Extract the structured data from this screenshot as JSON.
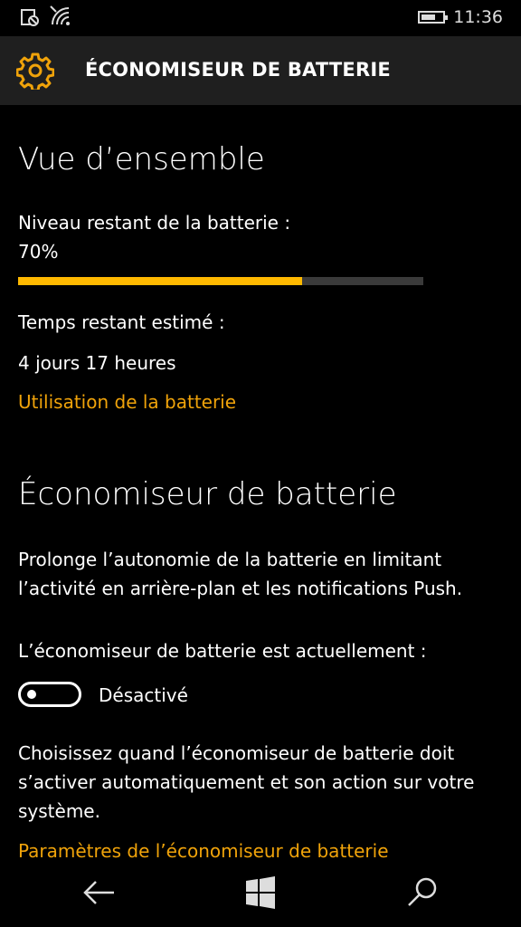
{
  "status": {
    "time": "11:36",
    "battery_level": 0.7
  },
  "header": {
    "title": "ÉCONOMISEUR DE BATTERIE",
    "icon": "gear-icon",
    "icon_color": "#f0a30a"
  },
  "overview": {
    "heading": "Vue d’ensemble",
    "level_label": "Niveau restant de la batterie :",
    "level_value": "70%",
    "level_fraction": 0.7,
    "time_label": "Temps restant estimé :",
    "time_value": "4 jours 17 heures",
    "usage_link": "Utilisation de la batterie"
  },
  "saver": {
    "heading": "Économiseur de batterie",
    "description_line1": "Prolonge l’autonomie de la batterie en limitant",
    "description_line2": "l’activité en arrière-plan et les notifications Push.",
    "status_label": "L’économiseur de batterie est actuellement :",
    "toggle_state": "Désactivé",
    "toggle_on": false,
    "choose_line1": "Choisissez quand l’économiseur de batterie doit",
    "choose_line2": "s’activer automatiquement et son action sur votre",
    "choose_line3": "système.",
    "settings_link": "Paramètres de l’économiseur de batterie"
  },
  "nav": {
    "back": "back-arrow-icon",
    "home": "windows-logo-icon",
    "search": "search-icon"
  },
  "colors": {
    "accent": "#f0a30a",
    "bar_fill": "#ffb900",
    "header_bg": "#1f1f1f"
  }
}
